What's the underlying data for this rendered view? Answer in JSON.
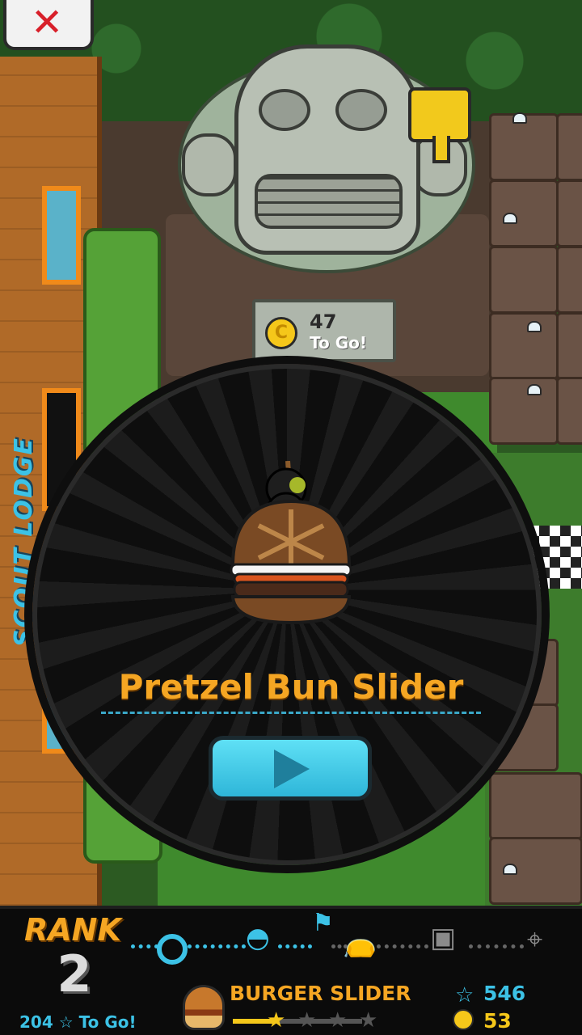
{
  "close_button": {
    "icon": "close-x-icon"
  },
  "lodge": {
    "sign": "SCOUT LODGE"
  },
  "coin_goal": {
    "count": "47",
    "label": "To Go!",
    "icon": "coin-icon"
  },
  "popup": {
    "item_name": "Pretzel Bun Slider",
    "play_icon": "play-icon"
  },
  "rank": {
    "title": "RANK",
    "number": "2",
    "points_to_go": "204",
    "to_go_label": "To Go!",
    "milestones": [
      "scout-badge-icon",
      "burger-icon",
      "flag-icon",
      "money-bag-icon",
      "gift-icon",
      "location-pin-icon"
    ]
  },
  "current_item": {
    "name": "BURGER SLIDER",
    "stars_earned": 1,
    "stars_total": 4,
    "progress": 0.33
  },
  "currency": {
    "stars": "546",
    "coins": "53"
  },
  "colors": {
    "accent_orange": "#f5a623",
    "accent_blue": "#3cc2e6",
    "coin_gold": "#f5c71a",
    "close_red": "#d8202a"
  }
}
